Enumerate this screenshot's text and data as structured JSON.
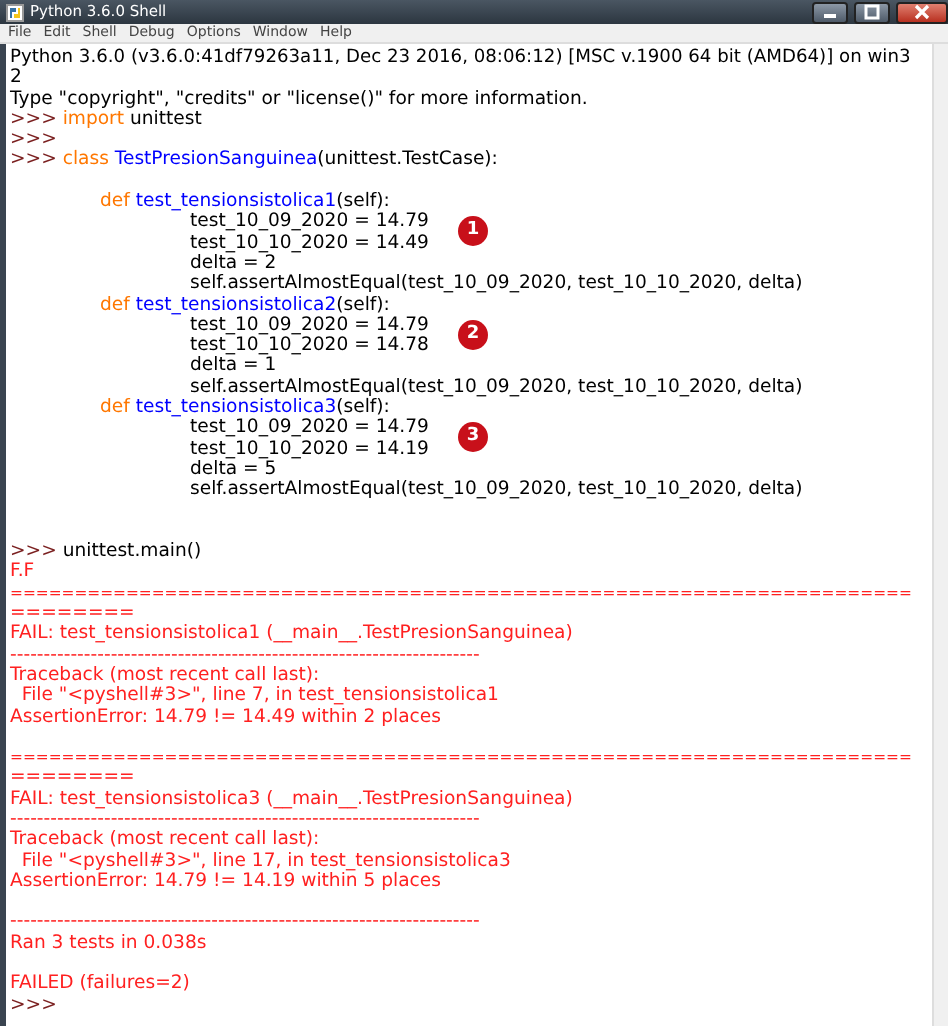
{
  "window": {
    "title": "Python 3.6.0 Shell"
  },
  "menu": [
    "File",
    "Edit",
    "Shell",
    "Debug",
    "Options",
    "Window",
    "Help"
  ],
  "lines": [
    {
      "kind": "text",
      "segments": [
        {
          "kind": "plain",
          "text": "Python 3.6.0 (v3.6.0:41df79263a11, Dec 23 2016, 08:06:12) [MSC v.1900 64 bit (AMD64)] on win3"
        }
      ]
    },
    {
      "kind": "text",
      "segments": [
        {
          "kind": "plain",
          "text": "2"
        }
      ]
    },
    {
      "kind": "text",
      "segments": [
        {
          "kind": "plain",
          "text": "Type \"copyright\", \"credits\" or \"license()\" for more information."
        }
      ]
    },
    {
      "kind": "text",
      "segments": [
        {
          "kind": "prompt",
          "text": ">>> "
        },
        {
          "kind": "keyword",
          "text": "import"
        },
        {
          "kind": "plain",
          "text": " unittest"
        }
      ]
    },
    {
      "kind": "text",
      "segments": [
        {
          "kind": "prompt",
          "text": ">>>"
        }
      ]
    },
    {
      "kind": "text",
      "segments": [
        {
          "kind": "prompt",
          "text": ">>> "
        },
        {
          "kind": "keyword",
          "text": "class "
        },
        {
          "kind": "defname",
          "text": "TestPresionSanguinea"
        },
        {
          "kind": "plain",
          "text": "(unittest.TestCase):"
        }
      ]
    },
    {
      "kind": "blank"
    },
    {
      "kind": "text",
      "segments": [
        {
          "kind": "keyword",
          "text": "\tdef "
        },
        {
          "kind": "defname",
          "text": "test_tensionsistolica1"
        },
        {
          "kind": "plain",
          "text": "(self):"
        }
      ]
    },
    {
      "kind": "text",
      "marker": "1",
      "segments": [
        {
          "kind": "plain",
          "text": "\t\ttest_10_09_2020 = 14.79"
        }
      ]
    },
    {
      "kind": "text",
      "segments": [
        {
          "kind": "plain",
          "text": "\t\ttest_10_10_2020 = 14.49"
        }
      ]
    },
    {
      "kind": "text",
      "segments": [
        {
          "kind": "plain",
          "text": "\t\tdelta = 2"
        }
      ]
    },
    {
      "kind": "text",
      "segments": [
        {
          "kind": "plain",
          "text": "\t\tself.assertAlmostEqual(test_10_09_2020, test_10_10_2020, delta)"
        }
      ]
    },
    {
      "kind": "text",
      "segments": [
        {
          "kind": "keyword",
          "text": "\tdef "
        },
        {
          "kind": "defname",
          "text": "test_tensionsistolica2"
        },
        {
          "kind": "plain",
          "text": "(self):"
        }
      ]
    },
    {
      "kind": "text",
      "marker": "2",
      "segments": [
        {
          "kind": "plain",
          "text": "\t\ttest_10_09_2020 = 14.79"
        }
      ]
    },
    {
      "kind": "text",
      "segments": [
        {
          "kind": "plain",
          "text": "\t\ttest_10_10_2020 = 14.78"
        }
      ]
    },
    {
      "kind": "text",
      "segments": [
        {
          "kind": "plain",
          "text": "\t\tdelta = 1"
        }
      ]
    },
    {
      "kind": "text",
      "segments": [
        {
          "kind": "plain",
          "text": "\t\tself.assertAlmostEqual(test_10_09_2020, test_10_10_2020, delta)"
        }
      ]
    },
    {
      "kind": "text",
      "segments": [
        {
          "kind": "keyword",
          "text": "\tdef "
        },
        {
          "kind": "defname",
          "text": "test_tensionsistolica3"
        },
        {
          "kind": "plain",
          "text": "(self):"
        }
      ]
    },
    {
      "kind": "text",
      "marker": "3",
      "segments": [
        {
          "kind": "plain",
          "text": "\t\ttest_10_09_2020 = 14.79"
        }
      ]
    },
    {
      "kind": "text",
      "segments": [
        {
          "kind": "plain",
          "text": "\t\ttest_10_10_2020 = 14.19"
        }
      ]
    },
    {
      "kind": "text",
      "segments": [
        {
          "kind": "plain",
          "text": "\t\tdelta = 5"
        }
      ]
    },
    {
      "kind": "text",
      "segments": [
        {
          "kind": "plain",
          "text": "\t\tself.assertAlmostEqual(test_10_09_2020, test_10_10_2020, delta)"
        }
      ]
    },
    {
      "kind": "blank"
    },
    {
      "kind": "blank"
    },
    {
      "kind": "text",
      "segments": [
        {
          "kind": "prompt",
          "text": ">>> "
        },
        {
          "kind": "plain",
          "text": "unittest.main()"
        }
      ]
    },
    {
      "kind": "text",
      "segments": [
        {
          "kind": "error",
          "text": "F.F"
        }
      ]
    },
    {
      "kind": "text",
      "segments": [
        {
          "kind": "error",
          "text": "======================================================================"
        }
      ]
    },
    {
      "kind": "text",
      "segments": [
        {
          "kind": "error",
          "text": "========"
        }
      ]
    },
    {
      "kind": "text",
      "segments": [
        {
          "kind": "error",
          "text": "FAIL: test_tensionsistolica1 (__main__.TestPresionSanguinea)"
        }
      ]
    },
    {
      "kind": "text",
      "segments": [
        {
          "kind": "error",
          "text": "----------------------------------------------------------------------"
        }
      ]
    },
    {
      "kind": "text",
      "segments": [
        {
          "kind": "error",
          "text": "Traceback (most recent call last):"
        }
      ]
    },
    {
      "kind": "text",
      "segments": [
        {
          "kind": "error",
          "text": "  File \"<pyshell#3>\", line 7, in test_tensionsistolica1"
        }
      ]
    },
    {
      "kind": "text",
      "segments": [
        {
          "kind": "error",
          "text": "AssertionError: 14.79 != 14.49 within 2 places"
        }
      ]
    },
    {
      "kind": "blank"
    },
    {
      "kind": "text",
      "segments": [
        {
          "kind": "error",
          "text": "======================================================================"
        }
      ]
    },
    {
      "kind": "text",
      "segments": [
        {
          "kind": "error",
          "text": "========"
        }
      ]
    },
    {
      "kind": "text",
      "segments": [
        {
          "kind": "error",
          "text": "FAIL: test_tensionsistolica3 (__main__.TestPresionSanguinea)"
        }
      ]
    },
    {
      "kind": "text",
      "segments": [
        {
          "kind": "error",
          "text": "----------------------------------------------------------------------"
        }
      ]
    },
    {
      "kind": "text",
      "segments": [
        {
          "kind": "error",
          "text": "Traceback (most recent call last):"
        }
      ]
    },
    {
      "kind": "text",
      "segments": [
        {
          "kind": "error",
          "text": "  File \"<pyshell#3>\", line 17, in test_tensionsistolica3"
        }
      ]
    },
    {
      "kind": "text",
      "segments": [
        {
          "kind": "error",
          "text": "AssertionError: 14.79 != 14.19 within 5 places"
        }
      ]
    },
    {
      "kind": "blank"
    },
    {
      "kind": "text",
      "segments": [
        {
          "kind": "error",
          "text": "----------------------------------------------------------------------"
        }
      ]
    },
    {
      "kind": "text",
      "segments": [
        {
          "kind": "error",
          "text": "Ran 3 tests in 0.038s"
        }
      ]
    },
    {
      "kind": "blank"
    },
    {
      "kind": "text",
      "segments": [
        {
          "kind": "error",
          "text": "FAILED (failures=2)"
        }
      ]
    },
    {
      "kind": "text",
      "segments": [
        {
          "kind": "prompt",
          "text": ">>>"
        }
      ]
    }
  ]
}
